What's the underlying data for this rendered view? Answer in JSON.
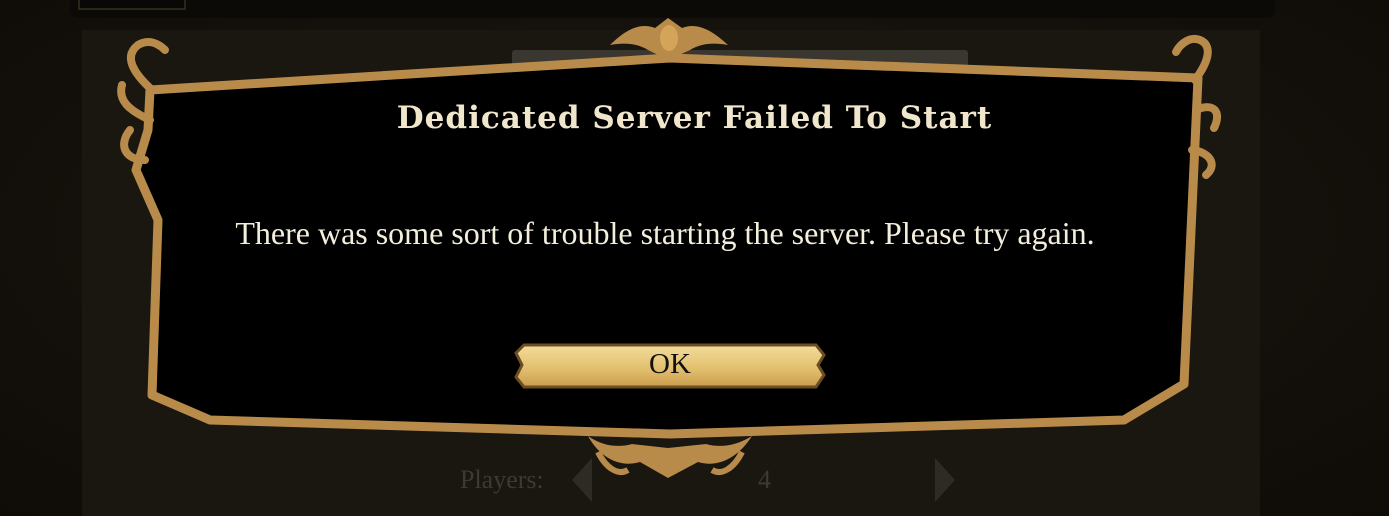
{
  "background": {
    "players_label": "Players:",
    "players_value": "4"
  },
  "dialog": {
    "title": "Dedicated Server Failed To Start",
    "message": "There was some sort of trouble starting the server. Please try again.",
    "ok_label": "OK"
  },
  "colors": {
    "frame": "#b98b4a",
    "dialog_bg": "#000000",
    "button": "#e8c878",
    "title_text": "#efe6cc"
  }
}
